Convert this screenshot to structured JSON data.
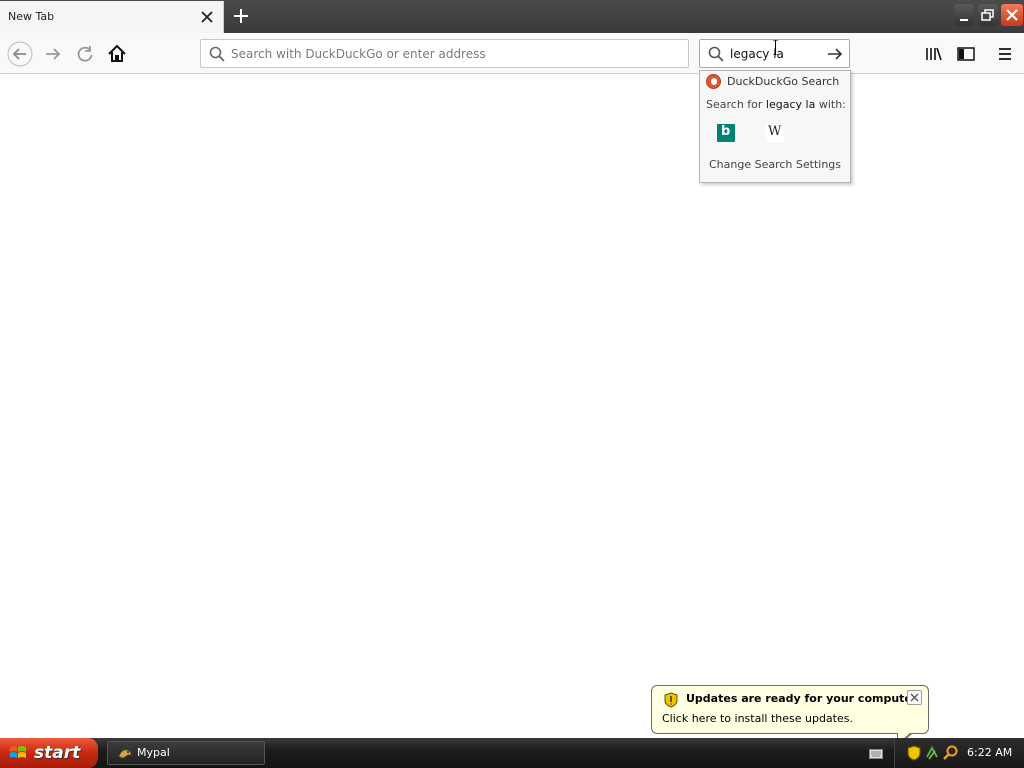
{
  "browser": {
    "tab": {
      "title": "New Tab"
    },
    "urlbar": {
      "placeholder": "Search with DuckDuckGo or enter address",
      "value": ""
    },
    "searchbar": {
      "value": "legacy la"
    }
  },
  "search_popup": {
    "engine_label": "DuckDuckGo Search",
    "search_for_prefix": "Search for ",
    "query": "legacy la",
    "search_for_suffix": " with:",
    "engines": [
      "bing-icon",
      "wikipedia-icon"
    ],
    "settings_label": "Change Search Settings"
  },
  "notification": {
    "title": "Updates are ready for your computer",
    "body": "Click here to install these updates."
  },
  "taskbar": {
    "start_label": "start",
    "items": [
      {
        "label": "Mypal"
      }
    ],
    "clock": "6:22 AM"
  },
  "colors": {
    "accent_start": "#c62a10",
    "bing": "#008373",
    "duckduckgo": "#de5833",
    "balloon_bg": "#ffffe1"
  }
}
